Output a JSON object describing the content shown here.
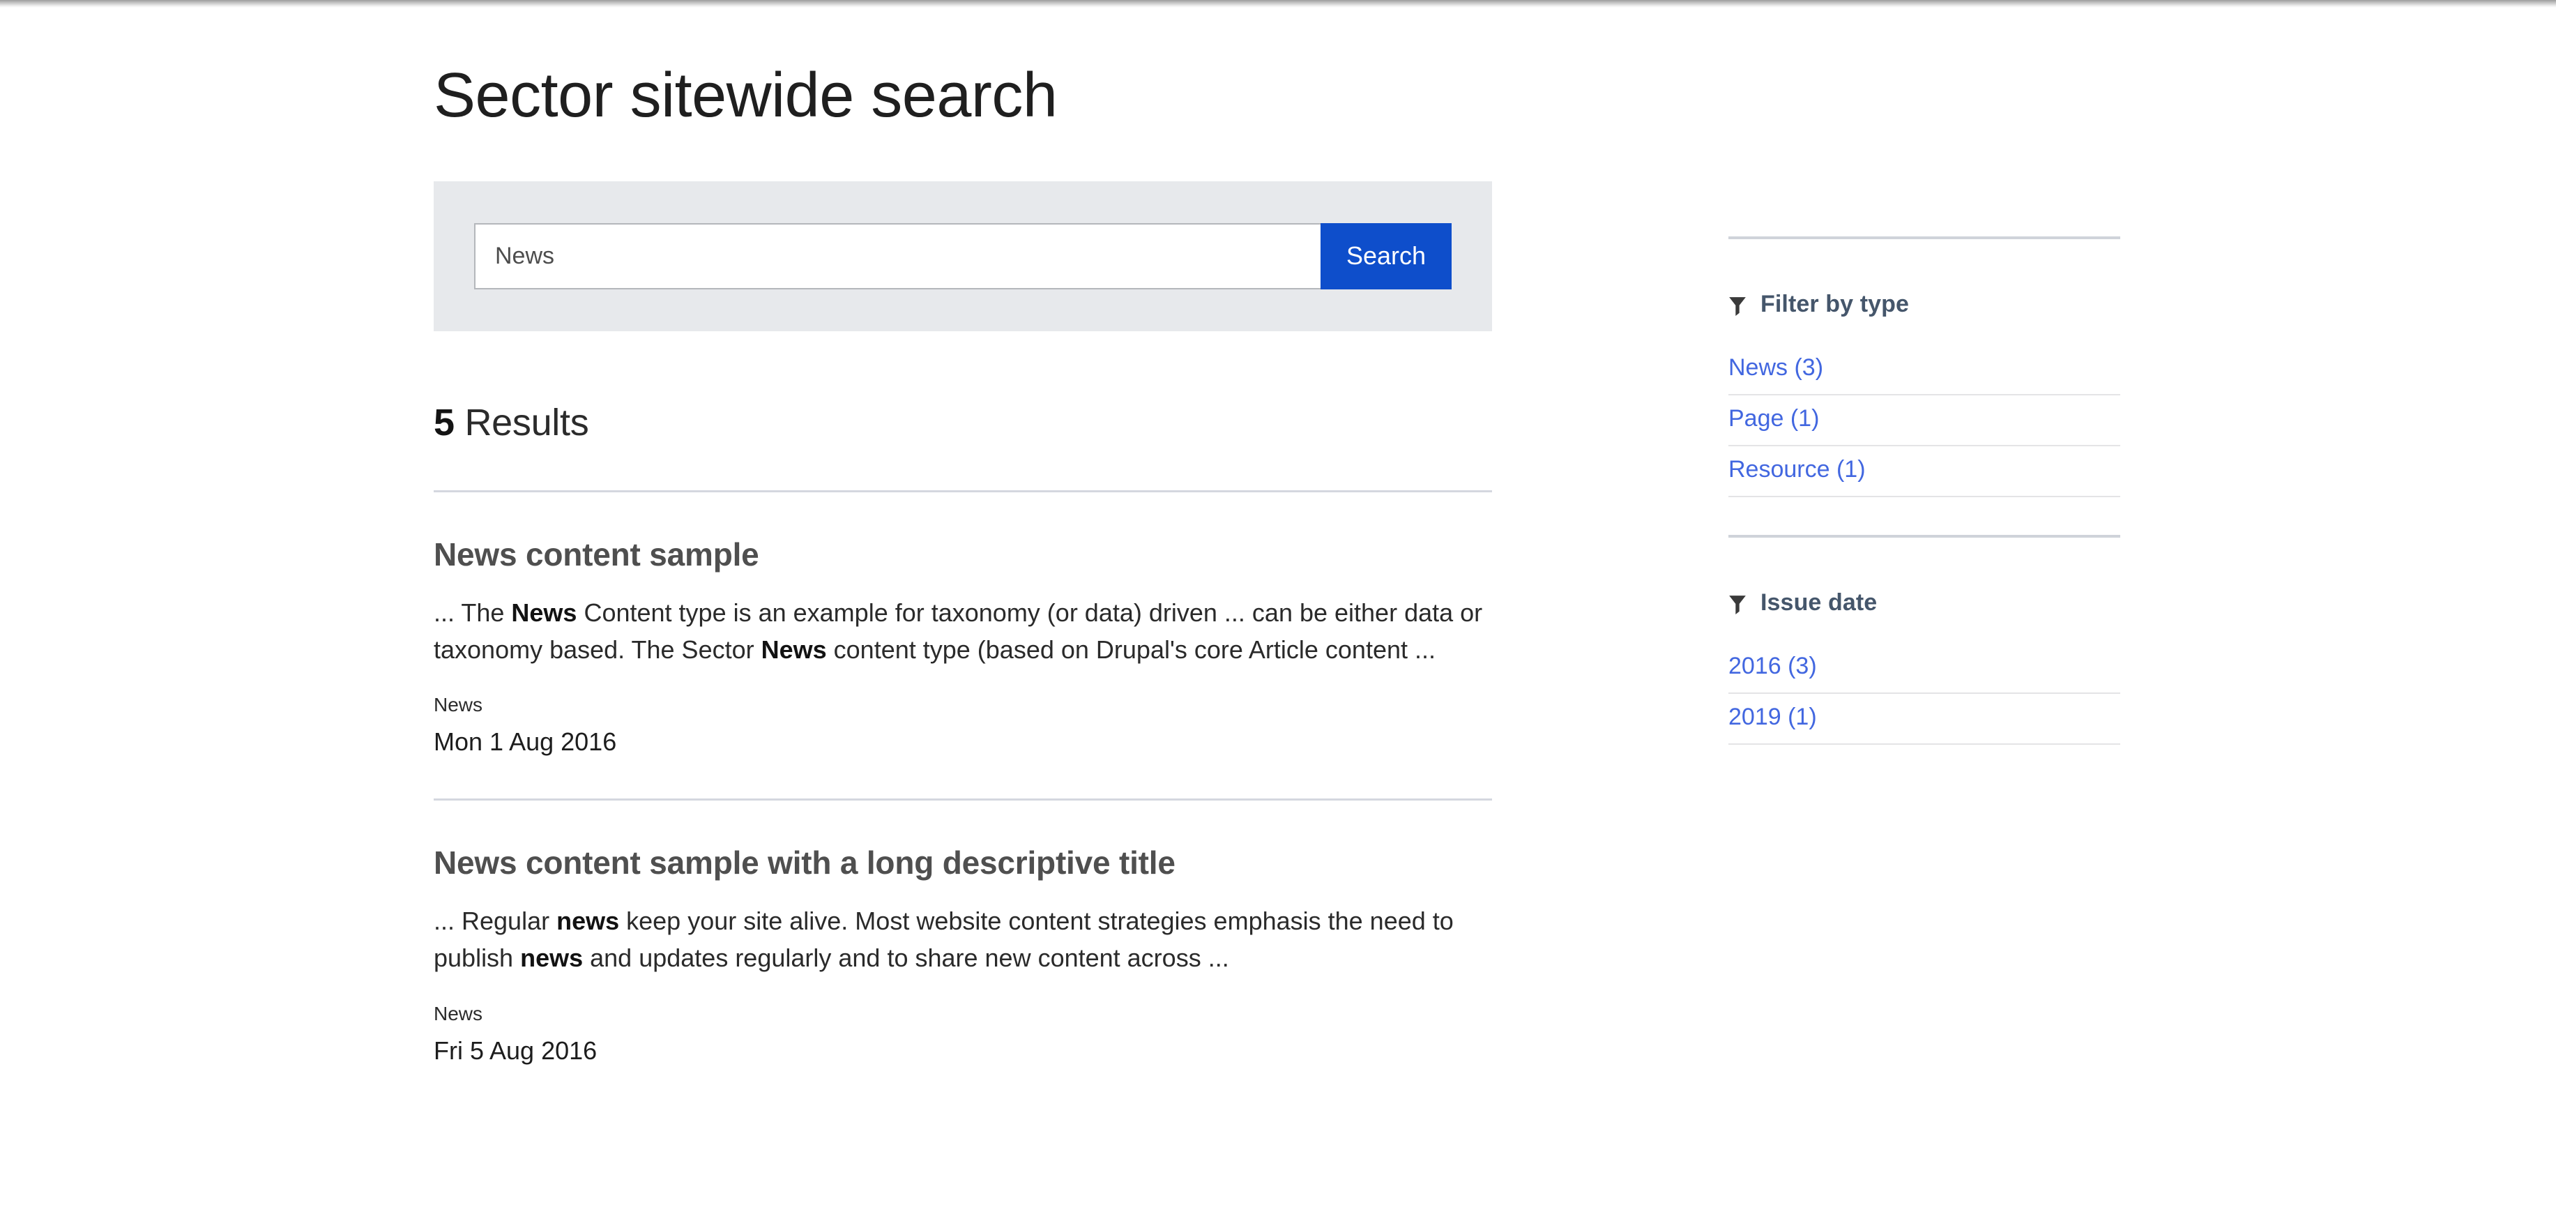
{
  "page": {
    "title": "Sector sitewide search"
  },
  "search": {
    "value": "News",
    "placeholder": "Search",
    "submit_label": "Search"
  },
  "results_header": {
    "count": "5",
    "label": "Results"
  },
  "results": [
    {
      "title": "News content sample",
      "snippet_parts": [
        {
          "text": "... The ",
          "bold": false
        },
        {
          "text": "News",
          "bold": true
        },
        {
          "text": " Content type is an example for taxonomy (or data) driven ... can be either data or taxonomy based.   The Sector ",
          "bold": false
        },
        {
          "text": "News",
          "bold": true
        },
        {
          "text": " content type (based on Drupal's core Article content ...",
          "bold": false
        }
      ],
      "type": "News",
      "date": "Mon 1 Aug 2016"
    },
    {
      "title": "News content sample with a long descriptive title",
      "snippet_parts": [
        {
          "text": "... Regular ",
          "bold": false
        },
        {
          "text": "news",
          "bold": true
        },
        {
          "text": " keep your site alive. Most website content strategies emphasis the need to publish ",
          "bold": false
        },
        {
          "text": "news",
          "bold": true
        },
        {
          "text": " and updates regularly and to share new content across ...",
          "bold": false
        }
      ],
      "type": "News",
      "date": "Fri 5 Aug 2016"
    }
  ],
  "facets": [
    {
      "heading": "Filter by type",
      "icon": "funnel-icon",
      "items": [
        {
          "label": "News (3)"
        },
        {
          "label": "Page (1)"
        },
        {
          "label": "Resource (1)"
        }
      ]
    },
    {
      "heading": "Issue date",
      "icon": "funnel-icon",
      "items": [
        {
          "label": "2016 (3)"
        },
        {
          "label": "2019 (1)"
        }
      ]
    }
  ],
  "colors": {
    "accent_button": "#0e4ecb",
    "link": "#4267e0",
    "facet_heading": "#45566b",
    "search_panel_bg": "#e7e9ec",
    "divider": "#d4d7df"
  }
}
